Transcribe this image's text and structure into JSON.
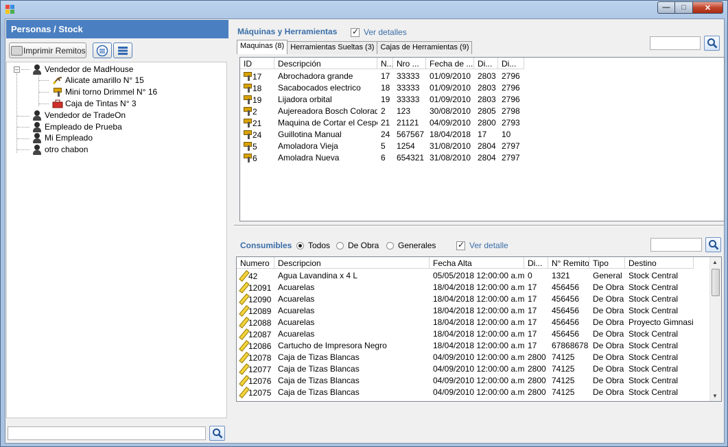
{
  "window": {
    "title": "",
    "accent": "#4a7fc1"
  },
  "left": {
    "header": "Personas  /  Stock",
    "print_label": "Imprimir Remitos",
    "tree": [
      {
        "label": "Vendedor de MadHouse",
        "level": 0,
        "icon": "person-icon",
        "expanded": true
      },
      {
        "label": "Alicate amarillo N° 15",
        "level": 1,
        "icon": "pliers-icon"
      },
      {
        "label": "Mini torno Drimmel N° 16",
        "level": 1,
        "icon": "drill-icon"
      },
      {
        "label": "Caja de Tintas N° 3",
        "level": 1,
        "icon": "toolbox-icon"
      },
      {
        "label": "Vendedor de TradeOn",
        "level": 0,
        "icon": "person-icon"
      },
      {
        "label": "Empleado de Prueba",
        "level": 0,
        "icon": "person-icon"
      },
      {
        "label": "Mi Empleado",
        "level": 0,
        "icon": "person-icon"
      },
      {
        "label": "otro chabon",
        "level": 0,
        "icon": "person-icon"
      }
    ],
    "search_value": ""
  },
  "machines": {
    "title": "Máquinas y Herramientas",
    "details_label": "Ver detalles",
    "details_checked": true,
    "search_value": "",
    "tabs": [
      "Maquinas (8)",
      "Herramientas Sueltas (3)",
      "Cajas de Herramientas (9)"
    ],
    "active_tab": 0,
    "columns": [
      "ID",
      "Descripción",
      "N...",
      "Nro ...",
      "Fecha de ...",
      "Di...",
      "Di..."
    ],
    "rows": [
      [
        "17",
        "Abrochadora grande",
        "17",
        "33333",
        "01/09/2010",
        "2803",
        "2796"
      ],
      [
        "18",
        "Sacabocados electrico",
        "18",
        "33333",
        "01/09/2010",
        "2803",
        "2796"
      ],
      [
        "19",
        "Lijadora orbital",
        "19",
        "33333",
        "01/09/2010",
        "2803",
        "2796"
      ],
      [
        "2",
        "Aujereadora Bosch Colorada",
        "2",
        "123",
        "30/08/2010",
        "2805",
        "2798"
      ],
      [
        "21",
        "Maquina de Cortar el Cesped",
        "21",
        "21121",
        "04/09/2010",
        "2800",
        "2793"
      ],
      [
        "24",
        "Guillotina Manual",
        "24",
        "567567",
        "18/04/2018",
        "17",
        "10"
      ],
      [
        "5",
        "Amoladora Vieja",
        "5",
        "1254",
        "31/08/2010",
        "2804",
        "2797"
      ],
      [
        "6",
        "Amoladra Nueva",
        "6",
        "654321",
        "31/08/2010",
        "2804",
        "2797"
      ]
    ]
  },
  "consumables": {
    "title": "Consumibles",
    "filters": [
      "Todos",
      "De Obra",
      "Generales"
    ],
    "selected_filter": 0,
    "details_label": "Ver detalle",
    "details_checked": true,
    "search_value": "",
    "columns": [
      "Numero",
      "Descripcion",
      "Fecha Alta",
      "Di...",
      "N° Remito",
      "Tipo",
      "Destino"
    ],
    "rows": [
      [
        "42",
        "Agua Lavandina x 4 L",
        "05/05/2018 12:00:00 a.m.",
        "0",
        "1321",
        "General",
        "Stock Central"
      ],
      [
        "12091",
        "Acuarelas",
        "18/04/2018 12:00:00 a.m.",
        "17",
        "456456",
        "De Obra",
        "Stock Central"
      ],
      [
        "12090",
        "Acuarelas",
        "18/04/2018 12:00:00 a.m.",
        "17",
        "456456",
        "De Obra",
        "Stock Central"
      ],
      [
        "12089",
        "Acuarelas",
        "18/04/2018 12:00:00 a.m.",
        "17",
        "456456",
        "De Obra",
        "Stock Central"
      ],
      [
        "12088",
        "Acuarelas",
        "18/04/2018 12:00:00 a.m.",
        "17",
        "456456",
        "De Obra",
        "Proyecto Gimnasio"
      ],
      [
        "12087",
        "Acuarelas",
        "18/04/2018 12:00:00 a.m.",
        "17",
        "456456",
        "De Obra",
        "Stock Central"
      ],
      [
        "12086",
        "Cartucho de Impresora Negro",
        "18/04/2018 12:00:00 a.m.",
        "17",
        "67868678",
        "De Obra",
        "Stock Central"
      ],
      [
        "12078",
        "Caja de Tizas Blancas",
        "04/09/2010 12:00:00 a.m.",
        "2800",
        "74125",
        "De Obra",
        "Stock Central"
      ],
      [
        "12077",
        "Caja de Tizas Blancas",
        "04/09/2010 12:00:00 a.m.",
        "2800",
        "74125",
        "De Obra",
        "Stock Central"
      ],
      [
        "12076",
        "Caja de Tizas Blancas",
        "04/09/2010 12:00:00 a.m.",
        "2800",
        "74125",
        "De Obra",
        "Stock Central"
      ],
      [
        "12075",
        "Caja de Tizas Blancas",
        "04/09/2010 12:00:00 a.m.",
        "2800",
        "74125",
        "De Obra",
        "Stock Central"
      ]
    ]
  }
}
